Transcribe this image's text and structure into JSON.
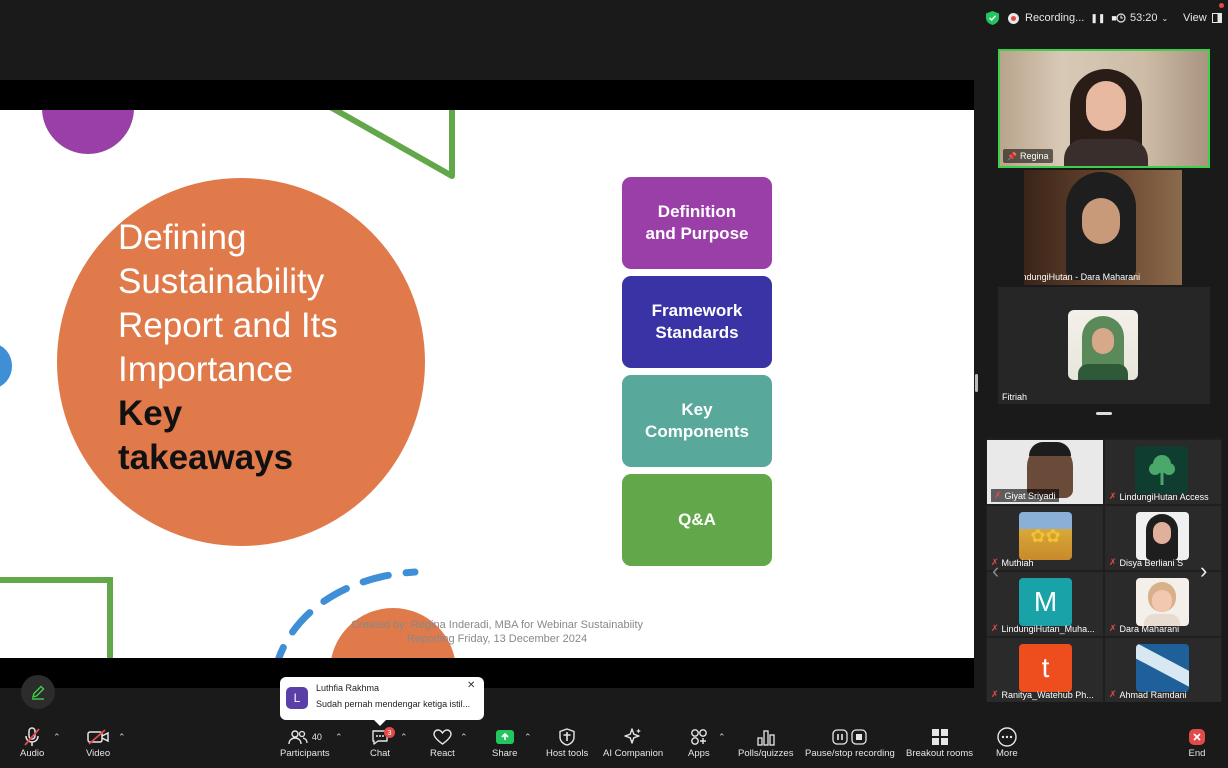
{
  "topbar": {
    "recording_label": "Recording...",
    "timer": "53:20",
    "view_label": "View"
  },
  "slide": {
    "title_lines": [
      "Defining",
      "Sustainability",
      "Report and Its",
      "Importance"
    ],
    "title_bold_lines": [
      "Key",
      "takeaways"
    ],
    "cards": [
      {
        "line1": "Definition",
        "line2": "and Purpose",
        "color": "#9a3fa8"
      },
      {
        "line1": "Framework",
        "line2": "Standards",
        "color": "#3a33a6"
      },
      {
        "line1": "Key",
        "line2": "Components",
        "color": "#58a89c"
      },
      {
        "line1": "Q&A",
        "line2": "",
        "color": "#62a84a"
      }
    ],
    "credit_line1": "Created by: Regina Inderadi, MBA for Webinar Sustainabiity",
    "credit_line2": "Reporting Friday, 13 December 2024"
  },
  "speakers": [
    {
      "name": "Regina"
    },
    {
      "name": "LindungiHutan - Dara Maharani"
    },
    {
      "name": "Fitriah"
    }
  ],
  "gallery": [
    {
      "name": "Giyat Sriyadi",
      "avatar": ""
    },
    {
      "name": "LindungiHutan Access",
      "avatar": ""
    },
    {
      "name": "Muthiah",
      "avatar": ""
    },
    {
      "name": "Disya Berliani S",
      "avatar": ""
    },
    {
      "name": "LindungiHutan_Muha...",
      "avatar": "M"
    },
    {
      "name": "Dara Maharani",
      "avatar": ""
    },
    {
      "name": "Ranitya_Watehub Ph...",
      "avatar": "t"
    },
    {
      "name": "Ahmad Ramdani",
      "avatar": ""
    }
  ],
  "chat_toast": {
    "initial": "L",
    "sender": "Luthfia Rakhma",
    "message": "Sudah pernah mendengar ketiga istil..."
  },
  "toolbar": {
    "audio": "Audio",
    "video": "Video",
    "participants": "Participants",
    "participants_count": "40",
    "chat": "Chat",
    "chat_badge": "3",
    "react": "React",
    "share": "Share",
    "host_tools": "Host tools",
    "ai_companion": "AI Companion",
    "apps": "Apps",
    "polls": "Polls/quizzes",
    "pause_stop": "Pause/stop recording",
    "breakout": "Breakout rooms",
    "more": "More",
    "end": "End"
  },
  "colors": {
    "share_green": "#22c55e",
    "end_red": "#e24a4a",
    "active_speaker_border": "#3ecf4b"
  }
}
